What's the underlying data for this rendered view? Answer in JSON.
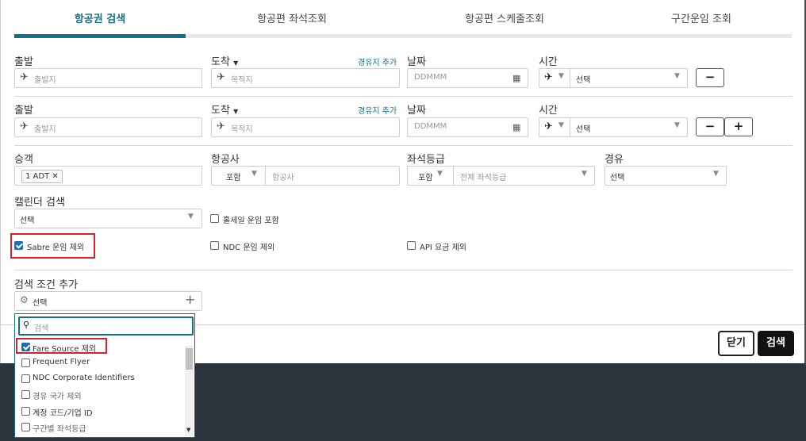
{
  "tabs": [
    {
      "label": "항공권 검색",
      "active": true
    },
    {
      "label": "항공편 좌석조회",
      "active": false
    },
    {
      "label": "항공편 스케줄조회",
      "active": false
    },
    {
      "label": "구간운임 조회",
      "active": false
    }
  ],
  "rows": [
    {
      "depart_label": "출발",
      "depart_placeholder": "출발지",
      "arrive_label": "도착",
      "arrive_placeholder": "목적지",
      "via_link": "경유지 추가",
      "date_label": "날짜",
      "date_placeholder": "DDMMM",
      "time_label": "시간",
      "time_value": "선택"
    },
    {
      "depart_label": "출발",
      "depart_placeholder": "출발지",
      "arrive_label": "도착",
      "arrive_placeholder": "목적지",
      "via_link": "경유지 추가",
      "date_label": "날짜",
      "date_placeholder": "DDMMM",
      "time_label": "시간",
      "time_value": "선택"
    }
  ],
  "buttons": {
    "minus": "−",
    "plus": "+",
    "close": "닫기",
    "search": "검색"
  },
  "passenger": {
    "label": "승객",
    "tag": "1 ADT",
    "remove": "✕"
  },
  "airline": {
    "label": "항공사",
    "mode": "포함",
    "placeholder": "항공사"
  },
  "cabin": {
    "label": "좌석등급",
    "mode": "포함",
    "placeholder": "전체 좌석등급"
  },
  "via": {
    "label": "경유",
    "value": "선택"
  },
  "calendar": {
    "label": "캘린더 검색",
    "value": "선택"
  },
  "options": {
    "wholesale": {
      "label": "홀세일 운임 포함",
      "checked": false
    },
    "sabre": {
      "label": "Sabre 운임 제외",
      "checked": true
    },
    "ndc": {
      "label": "NDC 운임 제외",
      "checked": false
    },
    "api": {
      "label": "API 요금 제외",
      "checked": false
    }
  },
  "add_criteria": {
    "label": "검색 조건 추가",
    "value": "선택"
  },
  "dropdown": {
    "search_placeholder": "검색",
    "items": [
      {
        "label": "Fare Source 제외",
        "checked": true
      },
      {
        "label": "Frequent Flyer",
        "checked": false
      },
      {
        "label": "NDC Corporate Identifiers",
        "checked": false
      },
      {
        "label": "경유 국가 제외",
        "checked": false
      },
      {
        "label": "계정 코드/기업 ID",
        "checked": false
      },
      {
        "label": "구간별 좌석등급",
        "checked": false
      }
    ]
  },
  "colors": {
    "accent": "#127087",
    "highlight": "#d9222a",
    "checkbox": "#1e6fa8",
    "footer_bg": "#2b343c"
  }
}
